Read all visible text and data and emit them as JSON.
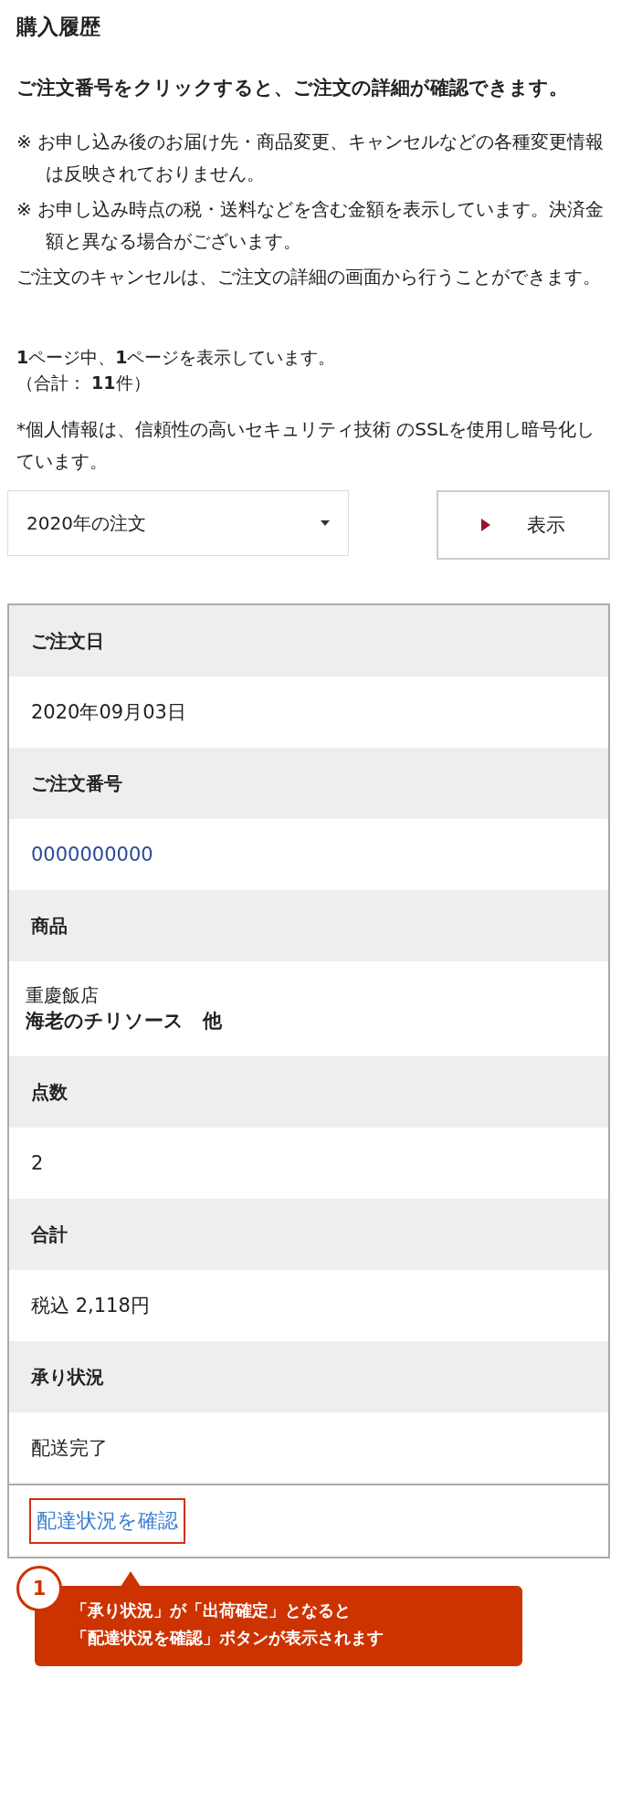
{
  "title": "購入履歴",
  "lead": "ご注文番号をクリックすると、ご注文の詳細が確認できます。",
  "notes": [
    "※ お申し込み後のお届け先・商品変更、キャンセルなどの各種変更情報は反映されておりません。",
    "※ お申し込み時点の税・送料などを含む金額を表示しています。決済金額と異なる場合がございます。"
  ],
  "cancel_note": "ご注文のキャンセルは、ご注文の詳細の画面から行うことができます。",
  "paging": {
    "pages": "**1**ページ中、**1**ページを表示しています。",
    "total": "（合計： **11**件）"
  },
  "ssl_note": "*個人情報は、信頼性の高いセキュリティ技術 のSSLを使用し暗号化しています。",
  "year_select": {
    "value": "2020年の注文"
  },
  "show_button": "表示",
  "order": {
    "fields": [
      {
        "label": "ご注文日",
        "kind": "text",
        "value": "2020年09月03日"
      },
      {
        "label": "ご注文番号",
        "kind": "link",
        "value": "0000000000"
      },
      {
        "label": "商品",
        "kind": "product",
        "shop": "重慶飯店",
        "value": "海老のチリソース　他"
      },
      {
        "label": "点数",
        "kind": "text",
        "value": "2"
      },
      {
        "label": "合計",
        "kind": "text",
        "value": "税込 2,118円"
      },
      {
        "label": "承り状況",
        "kind": "text",
        "value": "配送完了"
      }
    ],
    "tracking_link": "配達状況を確認"
  },
  "annotation": {
    "number": "1",
    "lines": [
      "「承り状況」が「出荷確定」となると",
      "「配達状況を確認」ボタンが表示されます"
    ]
  }
}
